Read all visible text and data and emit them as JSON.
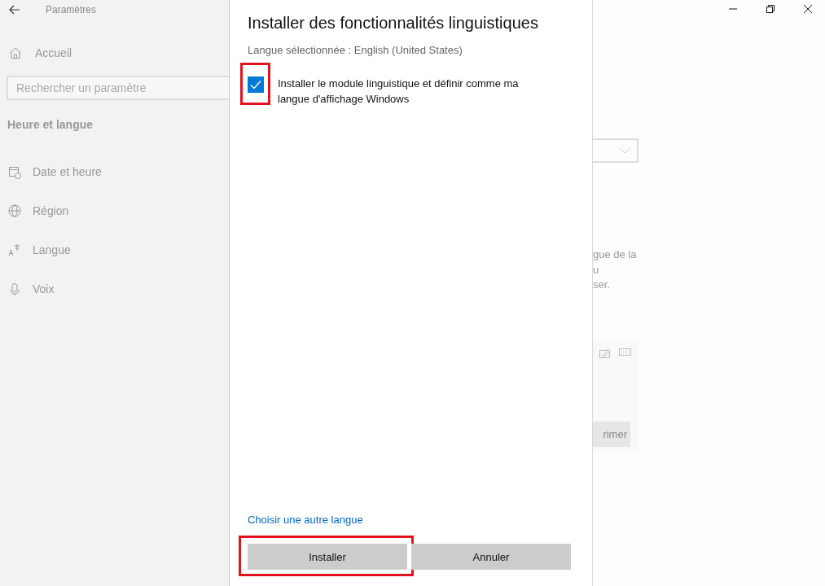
{
  "window": {
    "title": "Paramètres"
  },
  "sidebar": {
    "home": "Accueil",
    "search": {
      "placeholder": "Rechercher un paramètre"
    },
    "section": "Heure et langue",
    "items": [
      {
        "label": "Date et heure",
        "kind": "calendar"
      },
      {
        "label": "Région",
        "kind": "globe"
      },
      {
        "label": "Langue",
        "kind": "language"
      },
      {
        "label": "Voix",
        "kind": "microphone"
      }
    ]
  },
  "background": {
    "text_lines": [
      "gue de la",
      "u",
      "ser."
    ],
    "button": "rimer"
  },
  "dialog": {
    "title": "Installer des fonctionnalités linguistiques",
    "subtitle": "Langue sélectionnée : English (United States)",
    "checkbox": {
      "label": "Installer le module linguistique et définir comme ma langue d'affichage Windows",
      "checked": true,
      "highlighted": true
    },
    "link": "Choisir une autre langue",
    "buttons": [
      {
        "label": "Installer",
        "highlighted": true
      },
      {
        "label": "Annuler",
        "highlighted": false
      }
    ]
  }
}
